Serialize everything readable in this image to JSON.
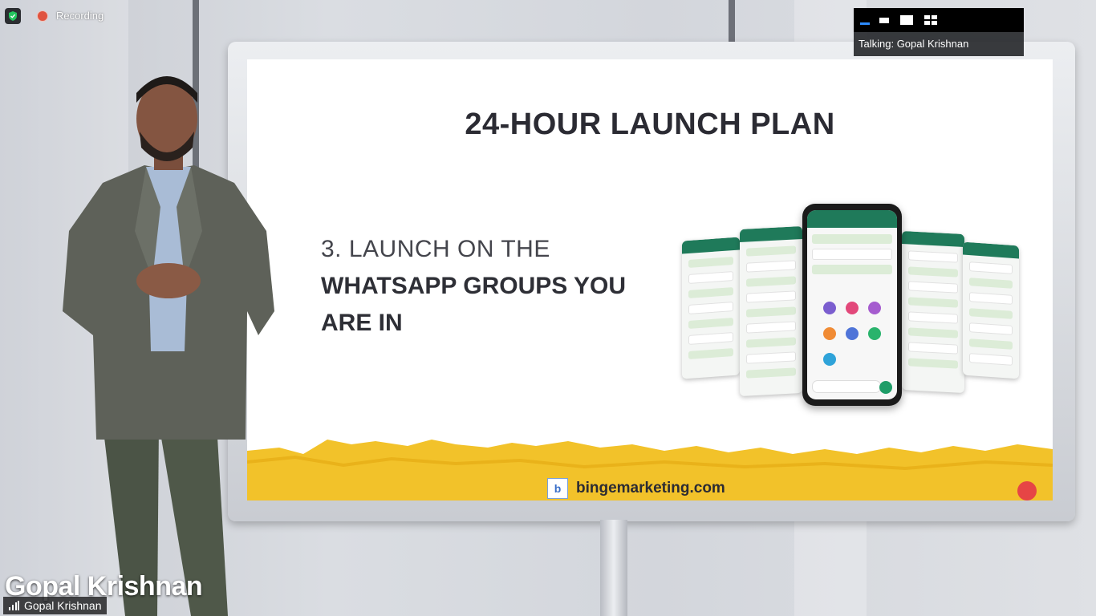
{
  "window": {
    "recording_label": "Recording",
    "talking_indicator": "Talking: Gopal Krishnan"
  },
  "view_toolbar": {
    "buttons": [
      "minimize-view",
      "speaker-view-small",
      "speaker-view",
      "gallery-view"
    ],
    "active": "minimize-view",
    "accent_color": "#2d8cff"
  },
  "slide": {
    "title": "24-HOUR LAUNCH PLAN",
    "step_line1": "3. LAUNCH ON THE",
    "step_line2": "WHATSAPP GROUPS YOU",
    "step_line3": "ARE IN",
    "website": "bingemarketing.com",
    "brand_color": "#f2c22a",
    "whatsapp_green": "#1f7a5a"
  },
  "participant": {
    "lower_third_name": "Gopal Krishnan",
    "name_tag": "Gopal Krishnan"
  },
  "icons": {
    "security": "shield-icon",
    "recording": "record-dot-icon",
    "signal": "signal-bars-icon",
    "site": "bingemarketing-logo-icon"
  }
}
